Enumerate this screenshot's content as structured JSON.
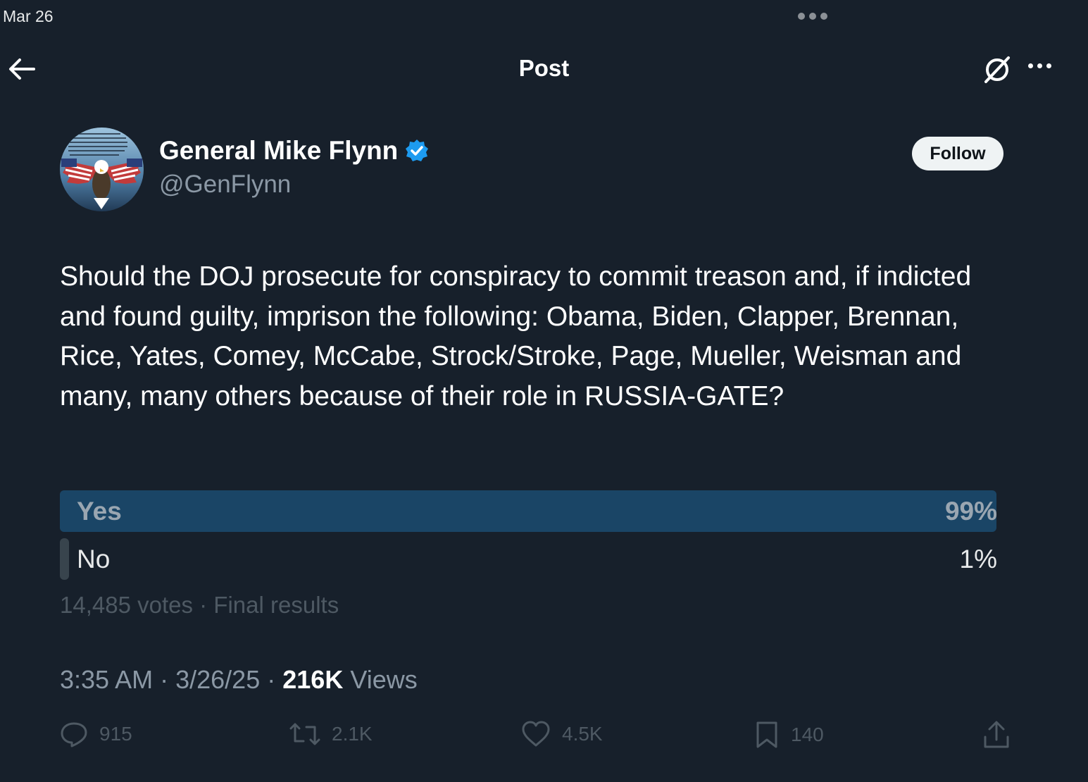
{
  "status_bar": {
    "date": "Mar 26"
  },
  "header": {
    "title": "Post",
    "back_icon": "arrow-left-icon",
    "grok_icon": "grok-icon",
    "more_icon": "more-horizontal-icon"
  },
  "author": {
    "name": "General Mike Flynn",
    "handle": "@GenFlynn",
    "verified": true,
    "follow_label": "Follow"
  },
  "tweet": {
    "text": "Should the DOJ prosecute for conspiracy to commit treason and, if indicted and found guilty, imprison the following: Obama, Biden, Clapper, Brennan, Rice, Yates, Comey, McCabe, Strock/Stroke, Page, Mueller, Weisman and many, many others because of their role in RUSSIA-GATE?"
  },
  "poll": {
    "options": [
      {
        "label": "Yes",
        "percent": "99%",
        "share": 0.99,
        "winner": true
      },
      {
        "label": "No",
        "percent": "1%",
        "share": 0.01,
        "winner": false
      }
    ],
    "meta": "14,485 votes · Final results"
  },
  "meta": {
    "time": "3:35 AM",
    "date": "3/26/25",
    "views_count": "216K",
    "views_label": "Views"
  },
  "actions": {
    "replies": "915",
    "reposts": "2.1K",
    "likes": "4.5K",
    "bookmarks": "140"
  },
  "colors": {
    "background": "#17202b",
    "poll_winner_bar": "#1a4566",
    "poll_loser_bar": "#38444d",
    "verified": "#1d9bf0",
    "muted_text": "#8b98a5"
  }
}
